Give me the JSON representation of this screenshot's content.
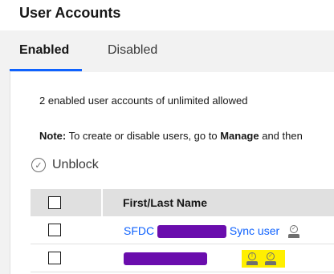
{
  "page": {
    "title": "User Accounts"
  },
  "tabs": [
    {
      "label": "Enabled",
      "active": true
    },
    {
      "label": "Disabled",
      "active": false
    }
  ],
  "summary": "2 enabled user accounts of unlimited allowed",
  "note": {
    "label": "Note:",
    "text_before": " To create or disable users, go to ",
    "manage": "Manage",
    "text_after": " and then"
  },
  "toolbar": {
    "unblock_label": "Unblock",
    "unblock_icon": "check-circle-icon"
  },
  "table": {
    "columns": [
      "First/Last Name"
    ],
    "rows": [
      {
        "name_prefix": "SFDC",
        "name_suffix": "Sync user",
        "redacted": true,
        "status_icons": [
          "user-check-icon"
        ]
      },
      {
        "name_prefix": "",
        "name_suffix": "",
        "redacted": true,
        "status_icons": [
          "user-alert-icon",
          "user-check-icon"
        ],
        "highlighted": true
      }
    ]
  },
  "colors": {
    "accent": "#0f62fe",
    "redaction": "#6a0dad",
    "highlight": "#ffef00"
  }
}
